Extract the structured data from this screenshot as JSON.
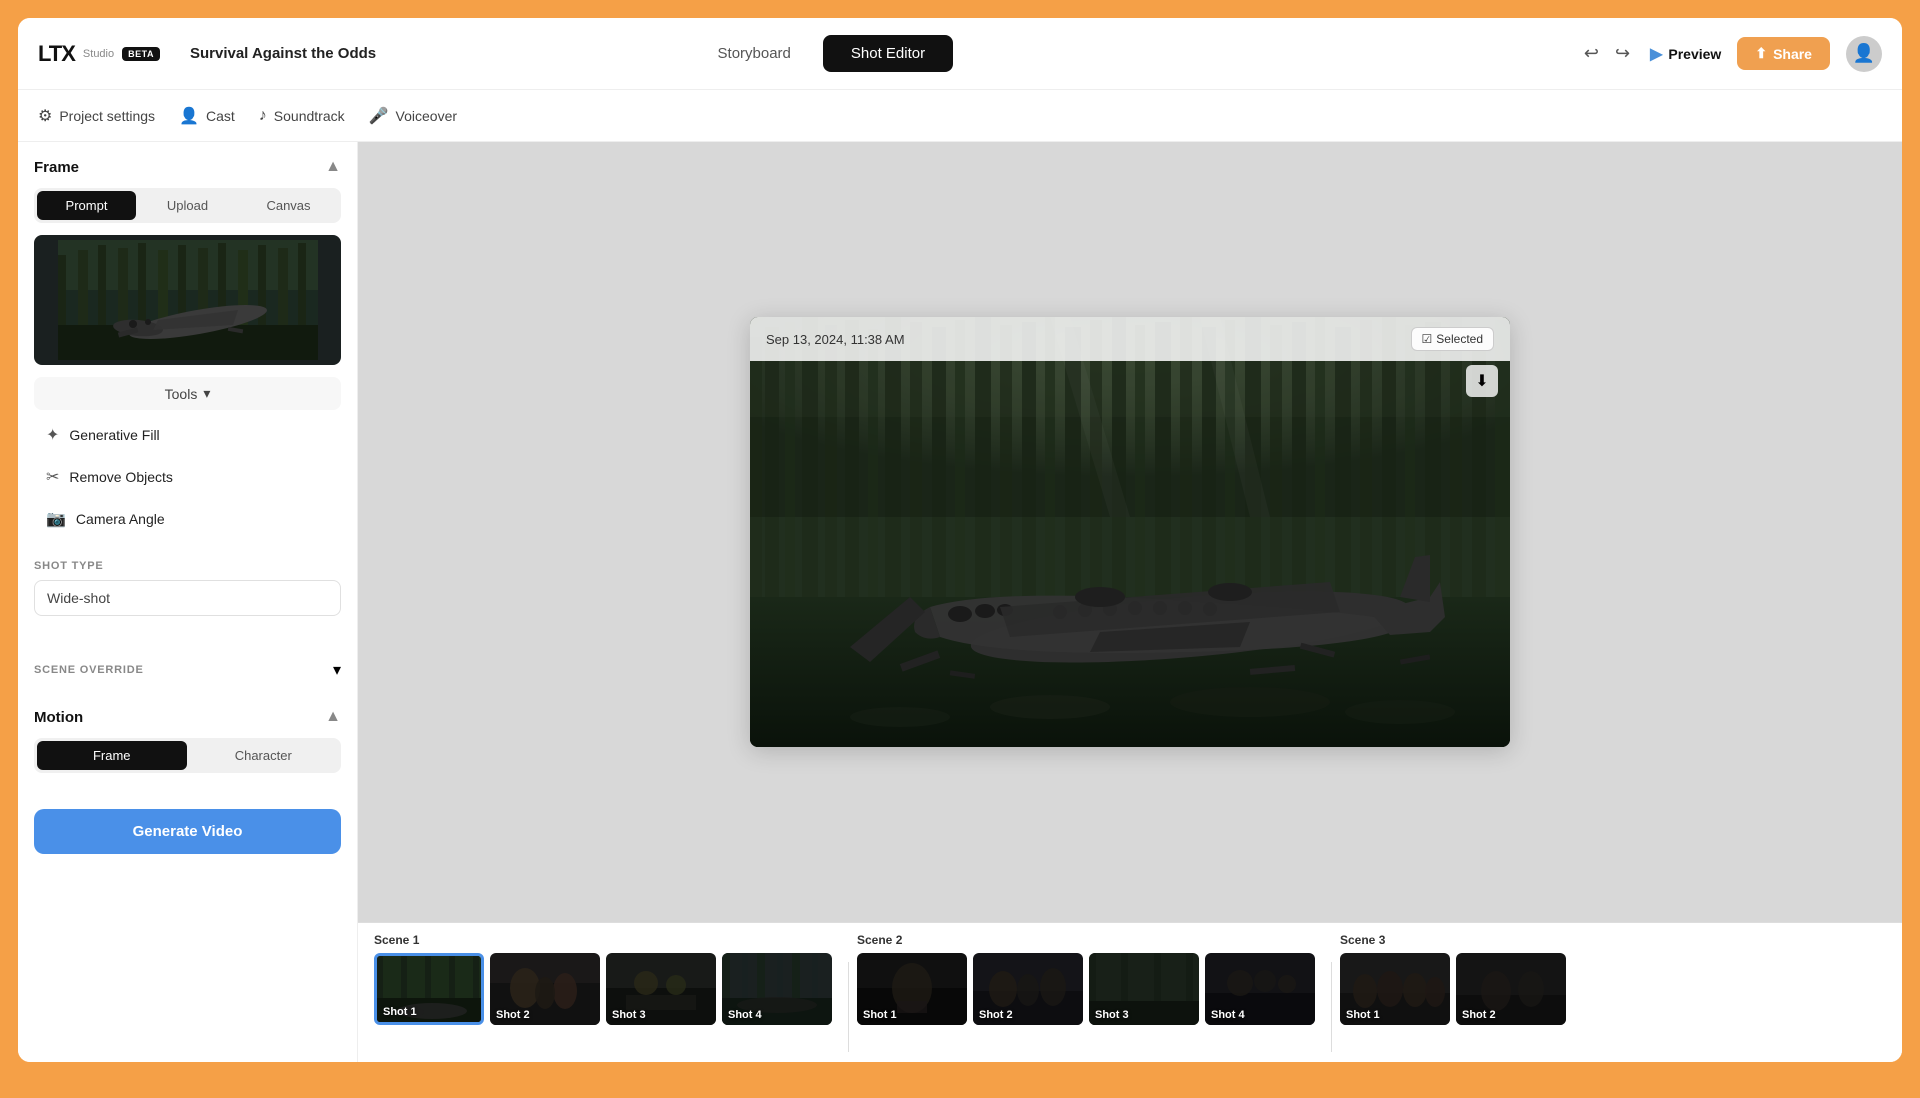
{
  "app": {
    "logo": "LTX",
    "studio_label": "Studio",
    "beta_label": "BETA",
    "project_title": "Survival Against the Odds"
  },
  "nav": {
    "storyboard_label": "Storyboard",
    "shot_editor_label": "Shot Editor"
  },
  "secondary_nav": {
    "project_settings_label": "Project settings",
    "cast_label": "Cast",
    "soundtrack_label": "Soundtrack",
    "voiceover_label": "Voiceover"
  },
  "toolbar": {
    "preview_label": "Preview",
    "share_label": "Share"
  },
  "left_panel": {
    "frame_section_title": "Frame",
    "tab_prompt": "Prompt",
    "tab_upload": "Upload",
    "tab_canvas": "Canvas",
    "tools_label": "Tools",
    "tool_generative_fill": "Generative Fill",
    "tool_remove_objects": "Remove Objects",
    "tool_camera_angle": "Camera Angle",
    "shot_type_label": "SHOT TYPE",
    "shot_type_value": "Wide-shot",
    "scene_override_label": "SCENE OVERRIDE",
    "motion_section_title": "Motion",
    "motion_tab_frame": "Frame",
    "motion_tab_character": "Character",
    "generate_btn_label": "Generate Video"
  },
  "shot_viewer": {
    "timestamp": "Sep 13, 2024, 11:38 AM",
    "selected_label": "Selected"
  },
  "timeline": {
    "scenes": [
      {
        "label": "Scene 1",
        "shots": [
          {
            "id": "s1-shot1",
            "label": "Shot 1",
            "selected": true,
            "theme": "forest"
          },
          {
            "id": "s1-shot2",
            "label": "Shot 2",
            "selected": false,
            "theme": "people"
          },
          {
            "id": "s1-shot3",
            "label": "Shot 3",
            "selected": false,
            "theme": "dark"
          },
          {
            "id": "s1-shot4",
            "label": "Shot 4",
            "selected": false,
            "theme": "outdoor"
          }
        ]
      },
      {
        "label": "Scene 2",
        "shots": [
          {
            "id": "s2-shot1",
            "label": "Shot 1",
            "selected": false,
            "theme": "dark"
          },
          {
            "id": "s2-shot2",
            "label": "Shot 2",
            "selected": false,
            "theme": "people"
          },
          {
            "id": "s2-shot3",
            "label": "Shot 3",
            "selected": false,
            "theme": "forest"
          },
          {
            "id": "s2-shot4",
            "label": "Shot 4",
            "selected": false,
            "theme": "dark"
          }
        ]
      },
      {
        "label": "Scene 3",
        "shots": [
          {
            "id": "s3-shot1",
            "label": "Shot 1",
            "selected": false,
            "theme": "group"
          },
          {
            "id": "s3-shot2",
            "label": "Shot 2",
            "selected": false,
            "theme": "dark"
          }
        ]
      }
    ]
  },
  "colors": {
    "accent_blue": "#4a90e8",
    "accent_orange": "#f0a050",
    "dark": "#111111",
    "selected_border": "#4a90e8"
  }
}
